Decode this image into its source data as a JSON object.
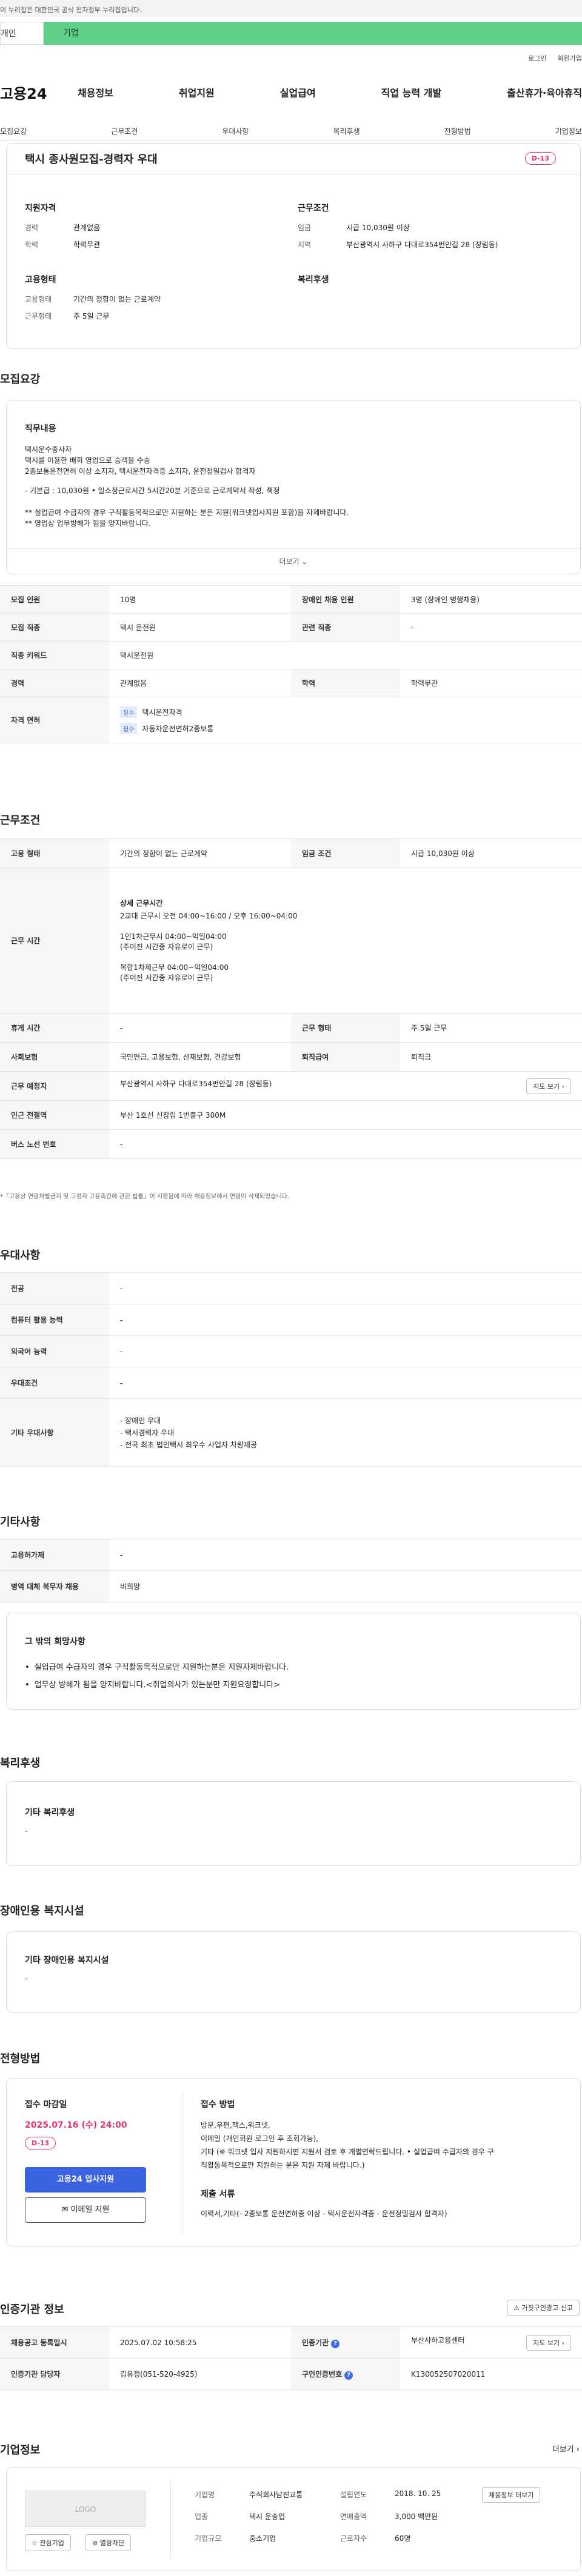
{
  "topbar": {
    "notice": "이 누리집은 대한민국 공식 전자정부 누리집입니다."
  },
  "tabs": {
    "individual": "개인",
    "corporate": "기업"
  },
  "util": {
    "login": "로그인",
    "signup": "회원가입"
  },
  "gnb": {
    "logo": "고용24",
    "items": [
      "채용정보",
      "취업지원",
      "실업급여",
      "직업 능력 개발",
      "출산휴가·육아휴직"
    ]
  },
  "subnav": {
    "items": [
      "모집요강",
      "근무조건",
      "우대사항",
      "복리후생",
      "전형방법",
      "기업정보"
    ]
  },
  "summary": {
    "title": "택시 종사원모집-경력자 우대",
    "dday": "D-13",
    "qual_h": "지원자격",
    "career_l": "경력",
    "career_v": "관계없음",
    "edu_l": "학력",
    "edu_v": "학력무관",
    "cond_h": "근무조건",
    "wage_l": "임금",
    "wage_v": "시급 10,030원 이상",
    "region_l": "지역",
    "region_v": "부산광역시 사하구 다대로354번안길 28 (장림동)",
    "emp_h": "고용형태",
    "emptype_l": "고용형태",
    "emptype_v": "기간의 정함이 없는 근로계약",
    "workform_l": "근무형태",
    "workform_v": "주 5일 근무",
    "welfare_h": "복리후생"
  },
  "recruit": {
    "heading": "모집요강",
    "job_h": "직무내용",
    "lines": [
      "택시운수종사자",
      "택시를 이용한 배회 영업으로 승객을 수송",
      "2종보통운전면허  이상 소지자, 택시운전자격증 소지자, 운전정밀검사 합격자",
      "- 기본급 : 10,030원 • 일소정근로시간 5시간20분 기준으로 근로계약서 작성, 책정",
      "**  실업급여 수급자의 경우 구직활동목적으로만 지원하는 분은 지원(워크넷입사지원 포함)을 자제바랍니다.",
      "**  영업상 업무방해가 됨을 양지바랍니다."
    ],
    "more": "더보기",
    "rows": [
      {
        "l1": "모집 인원",
        "v1": "10명",
        "l2": "장애인 채용 인원",
        "v2": "3명 (장애인 병행채용)"
      },
      {
        "l1": "모집 직종",
        "v1": "택시 운전원",
        "l2": "관련 직종",
        "v2": "-"
      },
      {
        "l1": "직종 키워드",
        "v1": "택시운전원"
      },
      {
        "l1": "경력",
        "v1": "관계없음",
        "l2": "학력",
        "v2": "학력무관"
      }
    ],
    "license_l": "자격 면허",
    "license_badge": "필수",
    "licenses": [
      "택시운전자격",
      "자동차운전면허2종보통"
    ]
  },
  "work": {
    "heading": "근무조건",
    "emptype_l": "고용 형태",
    "emptype_v": "기간의 정함이 없는 근로계약",
    "wage_l": "임금 조건",
    "wage_v": "시급 10,030원 이상",
    "hours_l": "근무 시간",
    "hours_h": "상세 근무시간",
    "hours_lines": [
      "2교대 근무시 오전 04:00~16:00 / 오후 16:00~04:00",
      "",
      "1인1차근무시 04:00~익일04:00",
      " (주어진 시간중 자유로이 근무)",
      "",
      "복합1차제근무 04:00~익일04:00",
      " (주어진 시간중 자유로이 근무)"
    ],
    "break_l": "휴게 시간",
    "break_v": "-",
    "form_l": "근무 형태",
    "form_v": "주 5일 근무",
    "ins_l": "사회보험",
    "ins_v": "국민연금, 고용보험, 산재보험, 건강보험",
    "sev_l": "퇴직급여",
    "sev_v": "퇴직금",
    "place_l": "근무 예정지",
    "place_v": "부산광역시 사하구 다대로354번안길 28 (장림동)",
    "map_btn": "지도 보기",
    "subway_l": "인근 전철역",
    "subway_v": "부산 1호선 신장림 1번출구 300M",
    "bus_l": "버스 노선 번호",
    "bus_v": "-",
    "note": "*「고용상 연령차별금지 및 고령자 고용촉진에 관한 법률」이 시행됨에 따라 채용정보에서 연령이 삭제되었습니다."
  },
  "pref": {
    "heading": "우대사항",
    "rows": [
      {
        "l": "전공",
        "v": "-"
      },
      {
        "l": "컴퓨터 활용 능력",
        "v": "-"
      },
      {
        "l": "외국어 능력",
        "v": "-"
      },
      {
        "l": "우대조건",
        "v": "-"
      }
    ],
    "etc_l": "기타 우대사항",
    "etc_v": [
      "- 장애인 우대",
      "- 택시경력자 우대",
      "- 전국 최초 법인택시 최우수 사업자 차량제공"
    ]
  },
  "other": {
    "heading": "기타사항",
    "subsidy_l": "고용허가제",
    "subsidy_v": "-",
    "military_l": "병역 대체 복무자 채용",
    "military_v": "비희망",
    "hope_h": "그 밖의 희망사항",
    "hope": [
      "실업급여 수급자의 경우 구직활동목적으로만 지원하는분은 지원자제바랍니다.",
      "업무상 방해가 됨을 양지바랍니다.<취업의사가 있는분만 지원요청합니다>"
    ]
  },
  "welfare": {
    "heading": "복리후생",
    "sub": "기타 복리후생",
    "v": "-"
  },
  "disab": {
    "heading": "장애인용 복지시설",
    "sub": "기타 장애인용 복지시설",
    "v": "-"
  },
  "apply": {
    "heading": "전형방법",
    "deadline_h": "접수 마감일",
    "deadline": "2025.07.16 (수) 24:00",
    "dday": "D-13",
    "apply_btn": "고용24 입사지원",
    "email_btn": "이메일 지원",
    "method_h": "접수 방법",
    "methods": [
      "방문,우편,팩스,워크넷,",
      "이메일 (개인회원 로그인 후 조회가능),",
      "기타 (※ 워크넷 입사 지원하시면 지원서 검토 후 개별연락드립니다. • 실업급여 수급자의 경우 구",
      "직활동목적으로만 지원하는 분은 지원 자제 바랍니다.)"
    ],
    "docs_h": "제출 서류",
    "docs": "이력서,기타(- 2종보통 운전면허증 이상 - 택시운전자격증 - 운전정밀검사 합격자)"
  },
  "auth": {
    "heading": "인증기관 정보",
    "report_btn": "거짓구인광고 신고",
    "reg_l": "채용공고 등록일시",
    "reg_v": "2025.07.02 10:58:25",
    "org_l": "인증기관",
    "org_v": "부산사하고용센터",
    "map_btn": "지도 보기",
    "mgr_l": "인증기관 담당자",
    "mgr_v": "김유정(051-520-4925)",
    "num_l": "구인인증번호",
    "num_v": "K130052507020011"
  },
  "company": {
    "heading": "기업정보",
    "more": "더보기",
    "logo": "LOGO",
    "fav_btn": "관심기업",
    "block_btn": "열람차단",
    "name_l": "기업명",
    "name_v": "주식회사남진교통",
    "found_l": "설립연도",
    "found_v": "2018. 10. 25",
    "map_btn": "채용정보 더보기",
    "ind_l": "업종",
    "ind_v": "택시 운송업",
    "sales_l": "연매출액",
    "sales_v": "3,000 백만원",
    "size_l": "기업규모",
    "size_v": "중소기업",
    "emp_l": "근로자수",
    "emp_v": "60명"
  }
}
